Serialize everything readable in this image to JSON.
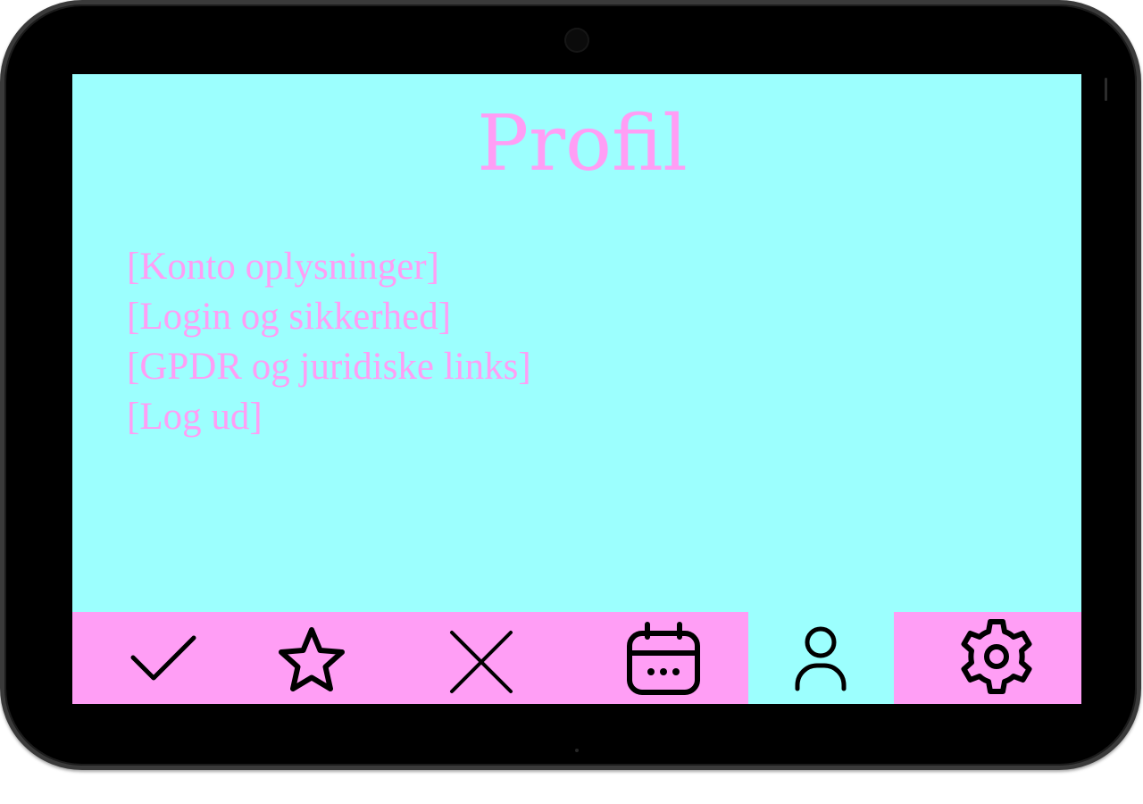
{
  "screen": {
    "title": "Profil"
  },
  "menu": {
    "items": [
      {
        "label": "[Konto oplysninger]"
      },
      {
        "label": "[Login og sikkerhed]"
      },
      {
        "label": "[GPDR og juridiske links]"
      },
      {
        "label": "[Log ud]"
      }
    ]
  },
  "nav": {
    "items": [
      {
        "icon": "check-icon"
      },
      {
        "icon": "star-icon"
      },
      {
        "icon": "close-icon"
      },
      {
        "icon": "calendar-icon"
      },
      {
        "icon": "user-icon",
        "active": true
      },
      {
        "icon": "gear-icon"
      }
    ]
  },
  "colors": {
    "background": "#9cfffe",
    "accent": "#ff9ef5",
    "icon": "#000000",
    "frame": "#000000"
  }
}
